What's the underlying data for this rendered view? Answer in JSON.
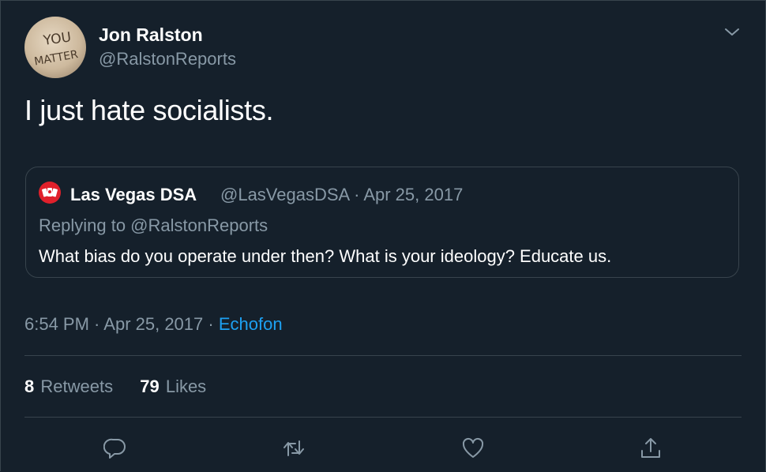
{
  "tweet": {
    "author_name": "Jon Ralston",
    "author_handle": "@RalstonReports",
    "avatar_text_top": "YOU",
    "avatar_text_bottom": "MATTER",
    "text": "I just hate socialists.",
    "time": "6:54 PM",
    "date": "Apr 25, 2017",
    "source": "Echofon",
    "separator": " · "
  },
  "quoted": {
    "author_name": "Las Vegas DSA",
    "meta": "@LasVegasDSA · Apr 25, 2017",
    "replying": "Replying to @RalstonReports",
    "text": "What bias do you operate under then? What is your ideology? Educate us."
  },
  "stats": {
    "retweets_count": "8",
    "retweets_label": "Retweets",
    "likes_count": "79",
    "likes_label": "Likes"
  },
  "icons": {
    "caret": "chevron-down-icon",
    "reply": "reply-icon",
    "retweet": "retweet-icon",
    "like": "heart-icon",
    "share": "share-icon"
  },
  "colors": {
    "background": "#15202b",
    "border": "#38444d",
    "muted_text": "#8899a6",
    "link": "#1da1f2",
    "dsa_red": "#e0202b"
  }
}
